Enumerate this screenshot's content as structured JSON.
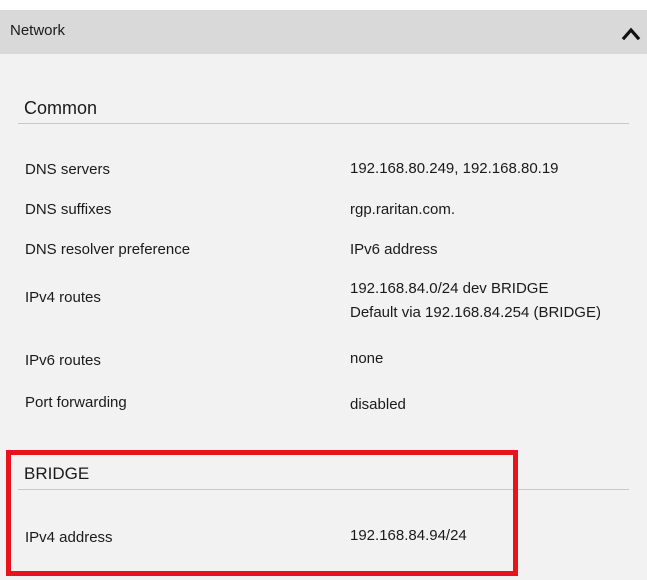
{
  "panel": {
    "title": "Network",
    "collapse_icon": "chevron-up-icon"
  },
  "common": {
    "title": "Common",
    "rows": [
      {
        "label": "DNS servers",
        "value": [
          "192.168.80.249, 192.168.80.19"
        ]
      },
      {
        "label": "DNS suffixes",
        "value": [
          "rgp.raritan.com."
        ]
      },
      {
        "label": "DNS resolver preference",
        "value": [
          "IPv6 address"
        ]
      },
      {
        "label": "IPv4 routes",
        "value": [
          "192.168.84.0/24 dev BRIDGE",
          "Default via 192.168.84.254 (BRIDGE)"
        ]
      },
      {
        "label": "IPv6 routes",
        "value": [
          "none"
        ]
      },
      {
        "label": "Port forwarding",
        "value": [
          "disabled"
        ]
      }
    ]
  },
  "bridge": {
    "title": "BRIDGE",
    "rows": [
      {
        "label": "IPv4 address",
        "value": [
          "192.168.84.94/24"
        ]
      }
    ]
  },
  "colors": {
    "header_bg": "#d9d9d9",
    "panel_bg": "#f2f2f2",
    "highlight": "#e8141c"
  }
}
